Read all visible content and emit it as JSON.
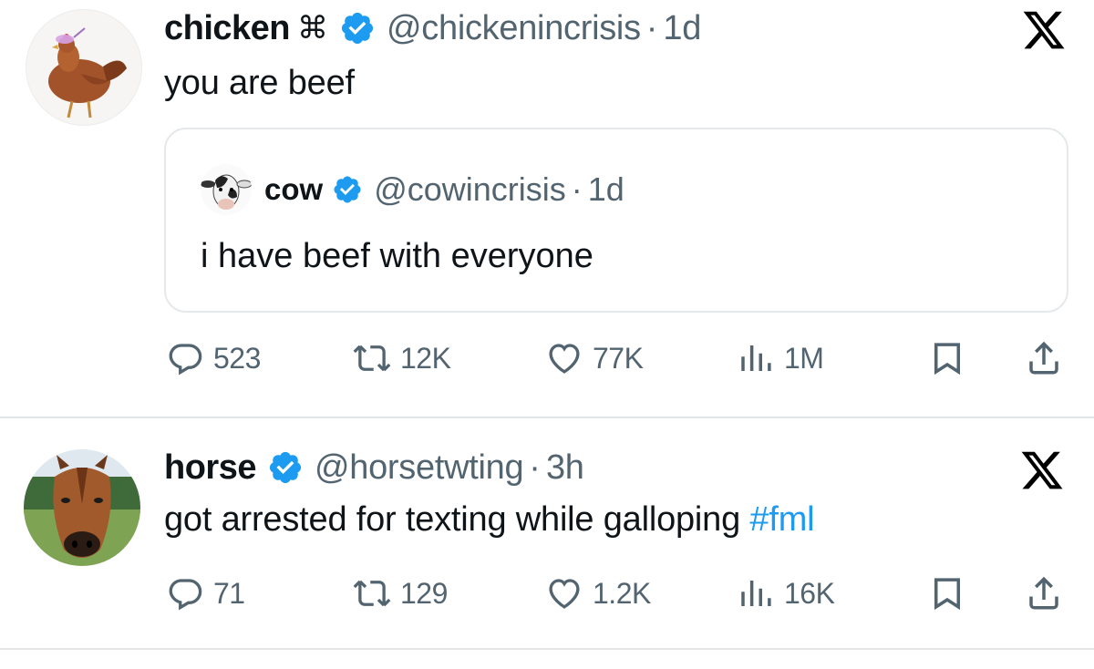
{
  "tweets": [
    {
      "author": {
        "name": "chicken",
        "name_symbol": "⌘",
        "handle": "@chickenincrisis",
        "time": "1d",
        "avatar": "chicken-avatar"
      },
      "text": "you are beef",
      "quote": {
        "author": {
          "name": "cow",
          "handle": "@cowincrisis",
          "time": "1d",
          "avatar": "cow-avatar"
        },
        "text": "i have beef with everyone"
      },
      "stats": {
        "replies": "523",
        "reposts": "12K",
        "likes": "77K",
        "views": "1M"
      }
    },
    {
      "author": {
        "name": "horse",
        "handle": "@horsetwting",
        "time": "3h",
        "avatar": "horse-avatar"
      },
      "text": "got arrested for texting while galloping",
      "hashtag": "#fml",
      "stats": {
        "replies": "71",
        "reposts": "129",
        "likes": "1.2K",
        "views": "16K"
      }
    }
  ],
  "ui": {
    "separator": "·",
    "icons": [
      "verified-badge-icon",
      "x-logo-icon",
      "reply-icon",
      "repost-icon",
      "like-icon",
      "views-icon",
      "bookmark-icon",
      "share-icon"
    ],
    "colors": {
      "text": "#0f1419",
      "secondary": "#536471",
      "link": "#1d9bf0",
      "verified": "#1d9bf0",
      "border": "#e3e6e8"
    }
  }
}
